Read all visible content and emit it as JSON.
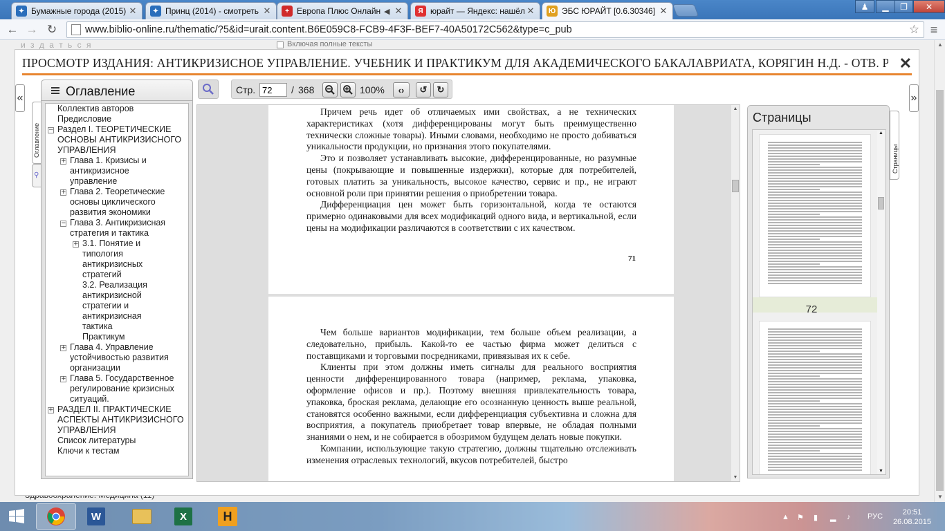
{
  "browser": {
    "tabs": [
      {
        "title": "Бумажные города (2015)",
        "icon": "site-icon",
        "icon_color": "#2a6ebb",
        "active": false,
        "audio": false
      },
      {
        "title": "Принц (2014) - смотреть",
        "icon": "site-icon",
        "icon_color": "#2a6ebb",
        "active": false,
        "audio": false
      },
      {
        "title": "Европа Плюс Онлайн",
        "icon": "europaplus-icon",
        "icon_color": "#d02a2a",
        "active": false,
        "audio": true
      },
      {
        "title": "юрайт — Яндекс: нашёл",
        "icon": "yandex-icon",
        "icon_color": "#e03030",
        "active": false,
        "audio": false
      },
      {
        "title": "ЭБС ЮРАЙТ [0.6.30346]",
        "icon": "urait-icon",
        "icon_color": "#e0a020",
        "active": true,
        "audio": false
      }
    ],
    "url": "www.biblio-online.ru/thematic/?5&id=urait.content.B6E059C8-FCB9-4F3F-BEF7-40A50172C562&type=c_pub"
  },
  "page_background": {
    "top_faded_text": "и з д а т ь с я",
    "checkbox_label": "Включая полные тексты",
    "bottom_text": "Здравоохранение. Медицина (11)"
  },
  "viewer": {
    "title": "ПРОСМОТР ИЗДАНИЯ: АНТИКРИЗИСНОЕ УПРАВЛЕНИЕ. УЧЕБНИК И ПРАКТИКУМ ДЛЯ АКАДЕМИЧЕСКОГО БАКАЛАВРИАТА, КОРЯГИН Н.Д. - ОТВ. РЕ...",
    "close_label": "✕",
    "left_tab_label": "Оглавление",
    "right_tab_label": "Страницы",
    "toc": {
      "title": "Оглавление",
      "items": [
        {
          "text": "Коллектив авторов",
          "expander": ""
        },
        {
          "text": "Предисловие",
          "expander": ""
        },
        {
          "text": "Раздел I. ТЕОРЕТИЧЕСКИЕ ОСНОВЫ АНТИКРИЗИСНОГО УПРАВЛЕНИЯ",
          "expander": "−"
        },
        {
          "text": "Глава 1. Кризисы и антикризисное управление",
          "expander": "+"
        },
        {
          "text": "Глава 2. Теоретические основы циклического развития экономики",
          "expander": "+"
        },
        {
          "text": "Глава 3. Антикризисная стратегия и тактика",
          "expander": "−"
        },
        {
          "text": "3.1. Понятие и типология антикризисных стратегий",
          "expander": "+"
        },
        {
          "text": "3.2. Реализация антикризисной стратегии и антикризисная тактика",
          "expander": ""
        },
        {
          "text": "Практикум",
          "expander": ""
        },
        {
          "text": "Глава 4. Управление устойчивостью развития организации",
          "expander": "+"
        },
        {
          "text": "Глава 5. Государственное регулирование кризисных ситуаций.",
          "expander": "+"
        },
        {
          "text": "РАЗДЕЛ II. ПРАКТИЧЕСКИЕ АСПЕКТЫ АНТИКРИЗИСНОГО УПРАВЛЕНИЯ",
          "expander": "+"
        },
        {
          "text": "Список литературы",
          "expander": ""
        },
        {
          "text": "Ключи к тестам",
          "expander": ""
        }
      ]
    },
    "toolbar": {
      "page_label": "Стр.",
      "page_value": "72",
      "page_separator": "/",
      "page_total": "368",
      "zoom": "100%"
    },
    "document": {
      "page1_paragraphs": [
        "Причем речь идет об отличаемых ими свойствах, а не технических характеристиках (хотя дифференцированы могут быть преимущественно технически сложные товары). Иными словами, необходимо не просто добиваться уникальности продукции, но признания этого покупателями.",
        "Это и позволяет устанавливать высокие, дифференцированные, но разумные цены (покрывающие и повышенные издержки), которые для потребителей, готовых платить за уникальность, высокое качество, сервис и пр., не играют основной роли при принятии решения о приобретении товара.",
        "Дифференциация цен может быть горизонтальной, когда те остаются примерно одинаковыми для всех модификаций одного вида, и вертикальной, если цены на модификации различаются в соответствии с их качеством."
      ],
      "page1_number": "71",
      "page2_paragraphs": [
        "Чем больше вариантов модификации, тем больше объем реализации, а следовательно, прибыль. Какой-то ее частью фирма может делиться с поставщиками и торговыми посредниками, привязывая их к себе.",
        "Клиенты при этом должны иметь сигналы для реального восприятия ценности дифференцированного товара (например, реклама, упаковка, оформление офисов и пр.). Поэтому внешняя привлекательность товара, упаковка, броская реклама, делающие его осознанную ценность выше реальной, становятся особенно важными, если дифференциация субъективна и сложна для восприятия, а покупатель приобретает товар впервые, не обладая полными знаниями о нем, и не собирается в обозримом будущем делать новые покупки.",
        "Компании, использующие такую стратегию, должны тщательно отслеживать изменения отраслевых технологий, вкусов потребителей, быстро"
      ]
    },
    "thumbnails": {
      "title": "Страницы",
      "current_page_label": "72"
    }
  },
  "taskbar": {
    "apps": [
      {
        "name": "chrome",
        "open": true
      },
      {
        "name": "word",
        "open": false
      },
      {
        "name": "explorer",
        "open": false
      },
      {
        "name": "excel",
        "open": false
      },
      {
        "name": "hamster",
        "open": false
      }
    ],
    "language": "РУС",
    "time": "20:51",
    "date": "26.08.2015"
  },
  "colors": {
    "accent_rule": "#e8852f",
    "browser_frame": "#3a75b9"
  }
}
